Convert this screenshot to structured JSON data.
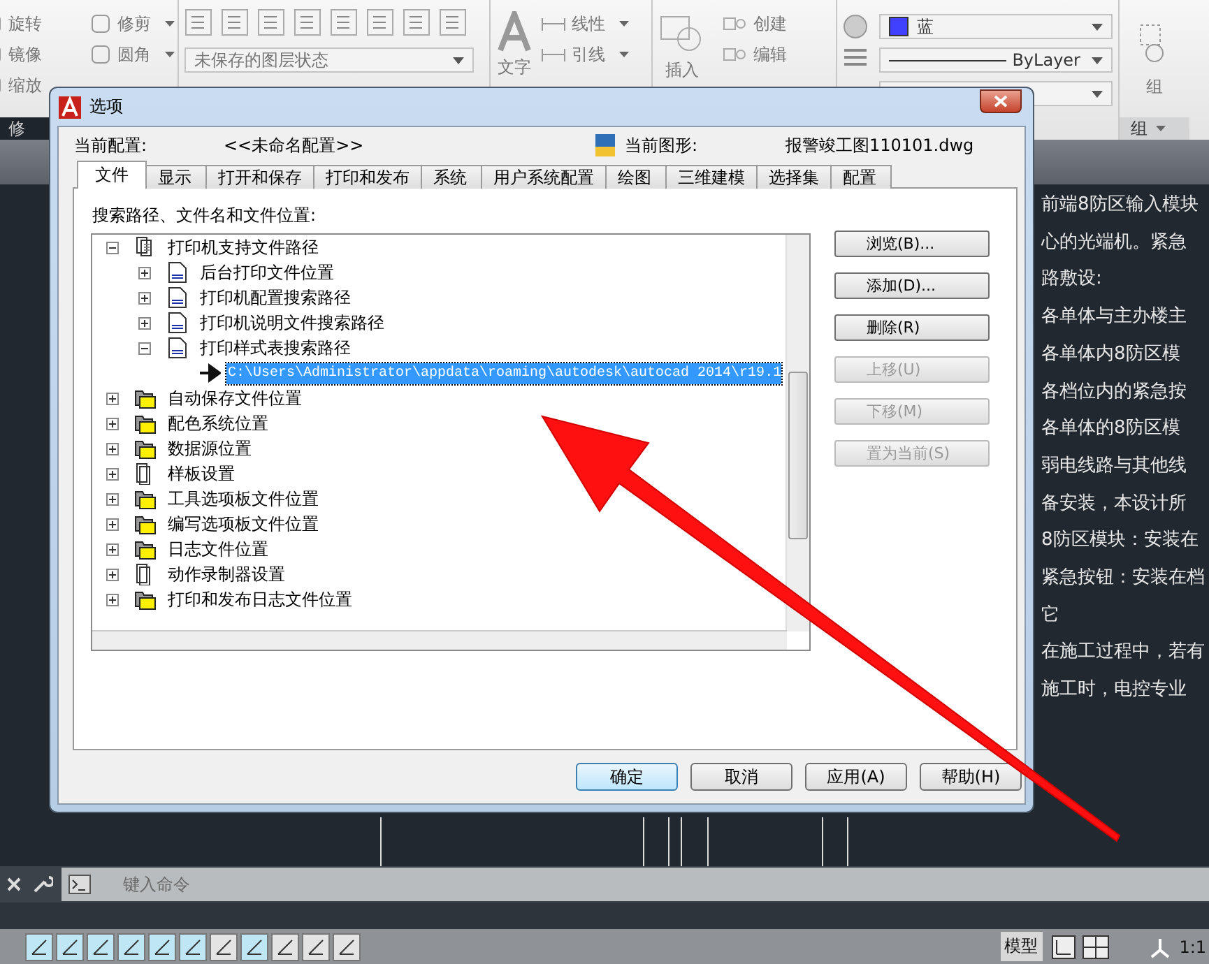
{
  "ribbon": {
    "modify": {
      "tools": [
        {
          "label": "旋转"
        },
        {
          "label": "修剪",
          "caret": true
        },
        {
          "label": "镜像"
        },
        {
          "label": "圆角",
          "caret": true
        },
        {
          "label": "缩放"
        }
      ],
      "panel_label": "修"
    },
    "layers": {
      "state_dropdown": "未保存的图层状态"
    },
    "annotation": {
      "big_tool": "文字",
      "tools": [
        {
          "label": "线性",
          "caret": true
        },
        {
          "label": "引线",
          "caret": true
        }
      ]
    },
    "block": {
      "big_tool": "插入",
      "tools": [
        {
          "label": "创建"
        },
        {
          "label": "编辑"
        }
      ]
    },
    "properties": {
      "color": {
        "value": "蓝",
        "color": "#4040ff"
      },
      "linetype": {
        "value": "ByLayer"
      }
    },
    "groups": {
      "tool": "组",
      "panel_label": "组"
    }
  },
  "drawing_text": [
    "前端8防区输入模块",
    "心的光端机。紧急",
    "路敷设:",
    "各单体与主办楼主",
    "各单体内8防区模",
    "各档位内的紧急按",
    "各单体的8防区模",
    "弱电线路与其他线",
    "备安装，本设计所",
    "8防区模块：安装在",
    "紧急按钮：安装在档",
    "它",
    "在施工过程中，若有",
    "施工时，电控专业"
  ],
  "command_line": {
    "placeholder": "键入命令"
  },
  "status_bar": {
    "toggles": [
      {
        "on": true
      },
      {
        "on": true
      },
      {
        "on": true
      },
      {
        "on": true
      },
      {
        "on": true
      },
      {
        "on": true
      },
      {
        "on": false
      },
      {
        "on": true
      },
      {
        "on": false
      },
      {
        "on": false
      },
      {
        "on": false
      }
    ],
    "model_label": "模型",
    "scale": "1:1"
  },
  "dialog": {
    "title": "选项",
    "profile_label": "当前配置:",
    "profile_value": "<<未命名配置>>",
    "drawing_label": "当前图形:",
    "drawing_value": "报警竣工图110101.dwg",
    "tabs": [
      {
        "label": "文件",
        "selected": true
      },
      {
        "label": "显示",
        "selected": false
      },
      {
        "label": "打开和保存",
        "selected": false
      },
      {
        "label": "打印和发布",
        "selected": false
      },
      {
        "label": "系统",
        "selected": false
      },
      {
        "label": "用户系统配置",
        "selected": false
      },
      {
        "label": "绘图",
        "selected": false
      },
      {
        "label": "三维建模",
        "selected": false
      },
      {
        "label": "选择集",
        "selected": false
      },
      {
        "label": "配置",
        "selected": false
      }
    ],
    "tree_label": "搜索路径、文件名和文件位置:",
    "tree": [
      {
        "label": "打印机支持文件路径",
        "kind": "pages",
        "expanded": true,
        "selected": false,
        "children": [
          {
            "label": "后台打印文件位置",
            "kind": "plt",
            "expanded": false,
            "selected": false
          },
          {
            "label": "打印机配置搜索路径",
            "kind": "plt",
            "expanded": false,
            "selected": false
          },
          {
            "label": "打印机说明文件搜索路径",
            "kind": "plt",
            "expanded": false,
            "selected": false
          },
          {
            "label": "打印样式表搜索路径",
            "kind": "plt",
            "expanded": true,
            "selected": false,
            "children": [
              {
                "label": "C:\\Users\\Administrator\\appdata\\roaming\\autodesk\\autocad 2014\\r19.1",
                "kind": "path",
                "selected": true
              }
            ]
          }
        ]
      },
      {
        "label": "自动保存文件位置",
        "kind": "folder",
        "expanded": false,
        "selected": false
      },
      {
        "label": "配色系统位置",
        "kind": "folder",
        "expanded": false,
        "selected": false
      },
      {
        "label": "数据源位置",
        "kind": "folder",
        "expanded": false,
        "selected": false
      },
      {
        "label": "样板设置",
        "kind": "page",
        "expanded": false,
        "selected": false
      },
      {
        "label": "工具选项板文件位置",
        "kind": "folder",
        "expanded": false,
        "selected": false
      },
      {
        "label": "编写选项板文件位置",
        "kind": "folder",
        "expanded": false,
        "selected": false
      },
      {
        "label": "日志文件位置",
        "kind": "folder",
        "expanded": false,
        "selected": false
      },
      {
        "label": "动作录制器设置",
        "kind": "page",
        "expanded": false,
        "selected": false
      },
      {
        "label": "打印和发布日志文件位置",
        "kind": "folder",
        "expanded": false,
        "selected": false
      }
    ],
    "side_buttons": [
      {
        "label": "浏览(B)...",
        "disabled": false
      },
      {
        "label": "添加(D)...",
        "disabled": false
      },
      {
        "label": "删除(R)",
        "disabled": false
      },
      {
        "label": "上移(U)",
        "disabled": true
      },
      {
        "label": "下移(M)",
        "disabled": true
      },
      {
        "label": "置为当前(S)",
        "disabled": true
      }
    ],
    "buttons": [
      {
        "label": "确定",
        "default": true
      },
      {
        "label": "取消",
        "default": false
      },
      {
        "label": "应用(A)",
        "default": false
      },
      {
        "label": "帮助(H)",
        "default": false
      }
    ]
  }
}
